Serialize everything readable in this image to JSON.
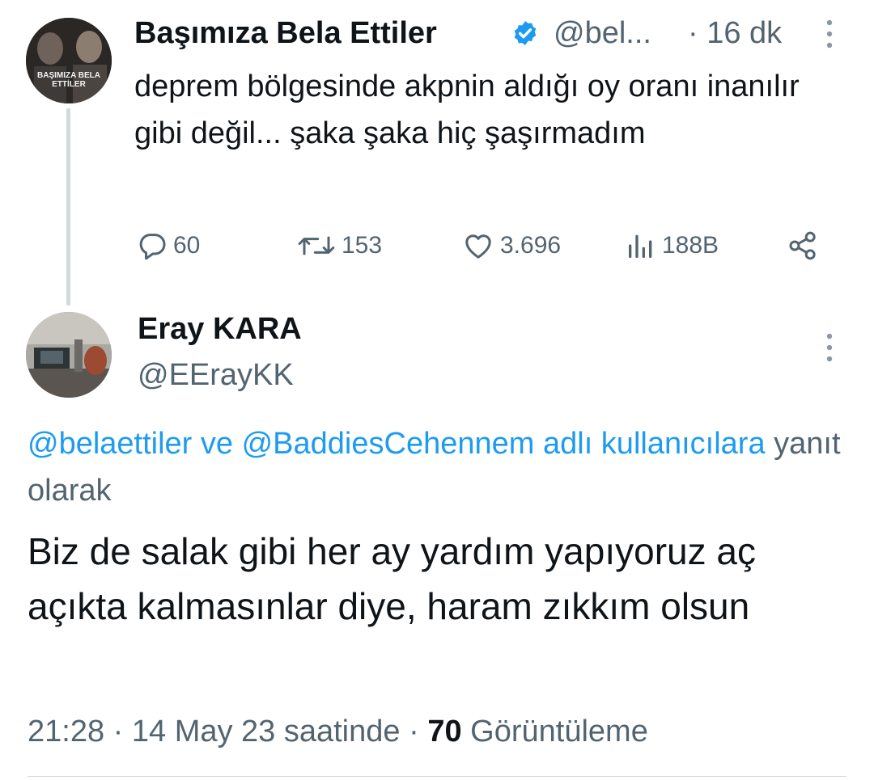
{
  "parent_tweet": {
    "avatar_text": "BAŞIMIZA BELA ETTİLER",
    "name": "Başımıza Bela Ettiler",
    "handle": "@bel...",
    "time": "· 16 dk",
    "text": "deprem bölgesinde akpnin aldığı oy oranı inanılır gibi değil... şaka şaka hiç şaşırmadım",
    "actions": {
      "replies": "60",
      "retweets": "153",
      "likes": "3.696",
      "views": "188B"
    },
    "icons": [
      "verified-badge-icon",
      "more-icon",
      "reply-icon",
      "retweet-icon",
      "like-icon",
      "views-icon",
      "share-icon"
    ]
  },
  "main_tweet": {
    "name": "Eray KARA",
    "handle": "@EErayKK",
    "reply_to": {
      "mention1": "@belaettiler",
      "connector": "ve",
      "mention2": "@BaddiesCehennem",
      "suffix_link": "adlı kullanıcılara",
      "suffix_text": "yanıt olarak"
    },
    "text": "Biz de salak gibi her ay yardım yapıyoruz aç açıkta kalmasınlar diye, haram zıkkım olsun",
    "time": "21:28 · 14 May 23 saatinde ·",
    "views_count": "70",
    "views_label": "Görüntüleme"
  },
  "colors": {
    "accent": "#1d9bf0",
    "text": "#0f1419",
    "secondary": "#536471",
    "divider": "#cfd9de"
  }
}
